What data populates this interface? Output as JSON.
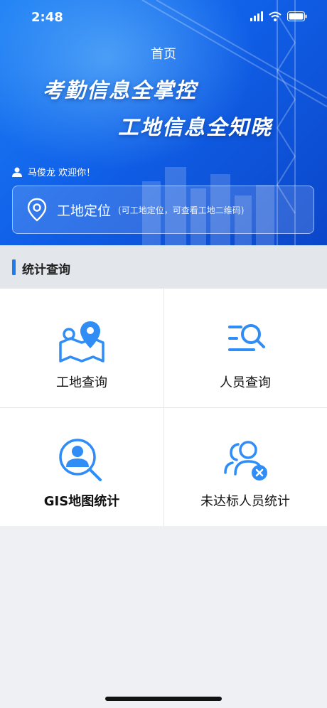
{
  "status": {
    "time": "2:48"
  },
  "header": {
    "title": "首页",
    "slogan_line1": "考勤信息全掌控",
    "slogan_line2": "工地信息全知晓",
    "welcome": "马俊龙 欢迎你！"
  },
  "locate": {
    "label": "工地定位",
    "hint": "(可工地定位，可查看工地二维码)"
  },
  "section": {
    "title": "统计查询"
  },
  "menu": [
    {
      "label": "工地查询",
      "icon": "map-pin-icon"
    },
    {
      "label": "人员查询",
      "icon": "list-search-icon"
    },
    {
      "label": "GIS地图统计",
      "icon": "person-search-icon"
    },
    {
      "label": "未达标人员统计",
      "icon": "users-x-icon"
    }
  ],
  "colors": {
    "accent": "#1f7cf0",
    "icon_blue": "#2f8df5",
    "hero_dark": "#0b46c9"
  }
}
